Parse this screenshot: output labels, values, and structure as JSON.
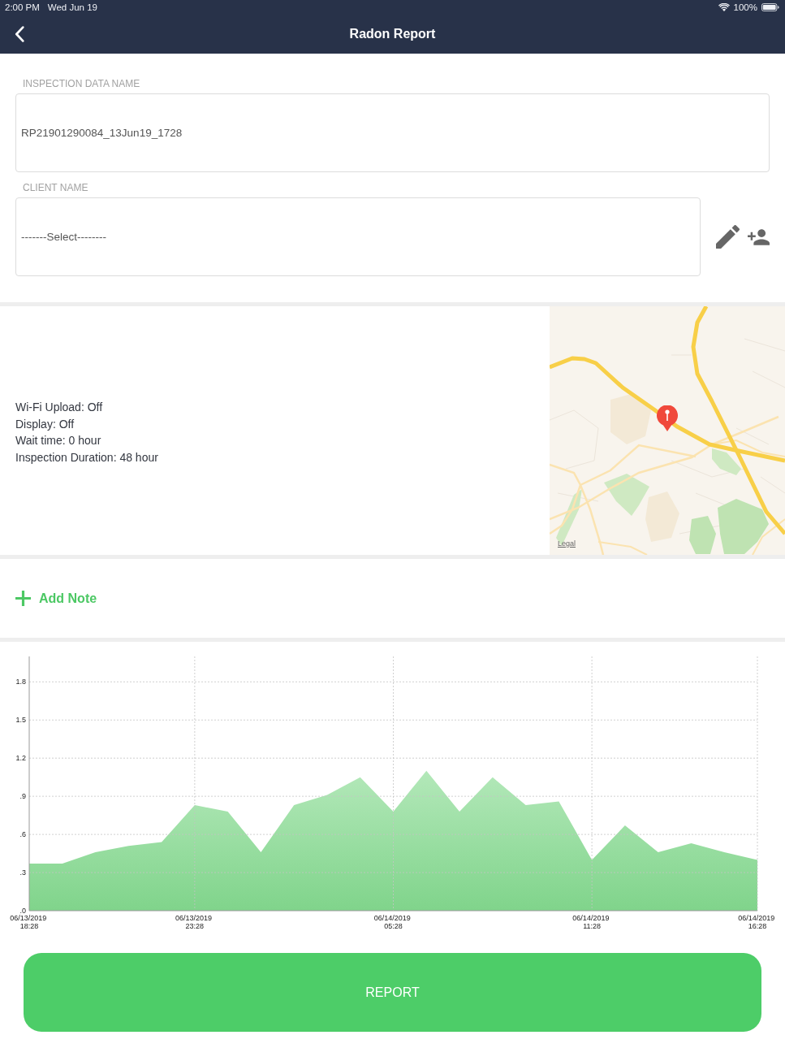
{
  "status_bar": {
    "time": "2:00 PM",
    "date": "Wed Jun 19",
    "battery": "100%"
  },
  "nav_bar": {
    "title": "Radon Report"
  },
  "form": {
    "fields": [
      {
        "kind": "text",
        "label": "INSPECTION DATA NAME",
        "value": "RP21901290084_13Jun19_1728"
      },
      {
        "kind": "select",
        "label": "CLIENT NAME",
        "value": "-------Select--------"
      }
    ]
  },
  "details": [
    "Wi-Fi Upload: Off",
    "Display: Off",
    "Wait time: 0 hour",
    "Inspection Duration: 48 hour"
  ],
  "map": {
    "legal_link": "Legal"
  },
  "add_note": {
    "label": "Add Note"
  },
  "chart": {
    "chart_data": {
      "type": "area",
      "grid": true,
      "categories": [
        "06/13/2019 18:28",
        null,
        null,
        null,
        null,
        "06/13/2019 23:28",
        null,
        null,
        null,
        null,
        null,
        "06/14/2019 05:28",
        null,
        null,
        null,
        null,
        null,
        "06/14/2019 11:28",
        null,
        null,
        null,
        null,
        "06/14/2019 16:28"
      ],
      "values": [
        0.37,
        0.37,
        0.46,
        0.51,
        0.54,
        0.83,
        0.78,
        0.46,
        0.83,
        0.91,
        1.05,
        0.78,
        1.1,
        0.78,
        1.05,
        0.83,
        0.86,
        0.4,
        0.67,
        0.46,
        0.53,
        0.46,
        0.4
      ],
      "ylim": [
        0,
        2
      ],
      "yticks": [
        {
          "value": 0,
          "label": ".0"
        },
        {
          "value": 0.3,
          "label": ".3"
        },
        {
          "value": 0.6,
          "label": ".6"
        },
        {
          "value": 0.9,
          "label": ".9"
        },
        {
          "value": 1.2,
          "label": "1.2"
        },
        {
          "value": 1.5,
          "label": "1.5"
        },
        {
          "value": 1.8,
          "label": "1.8"
        }
      ]
    }
  },
  "report_button": {
    "label": "REPORT"
  }
}
